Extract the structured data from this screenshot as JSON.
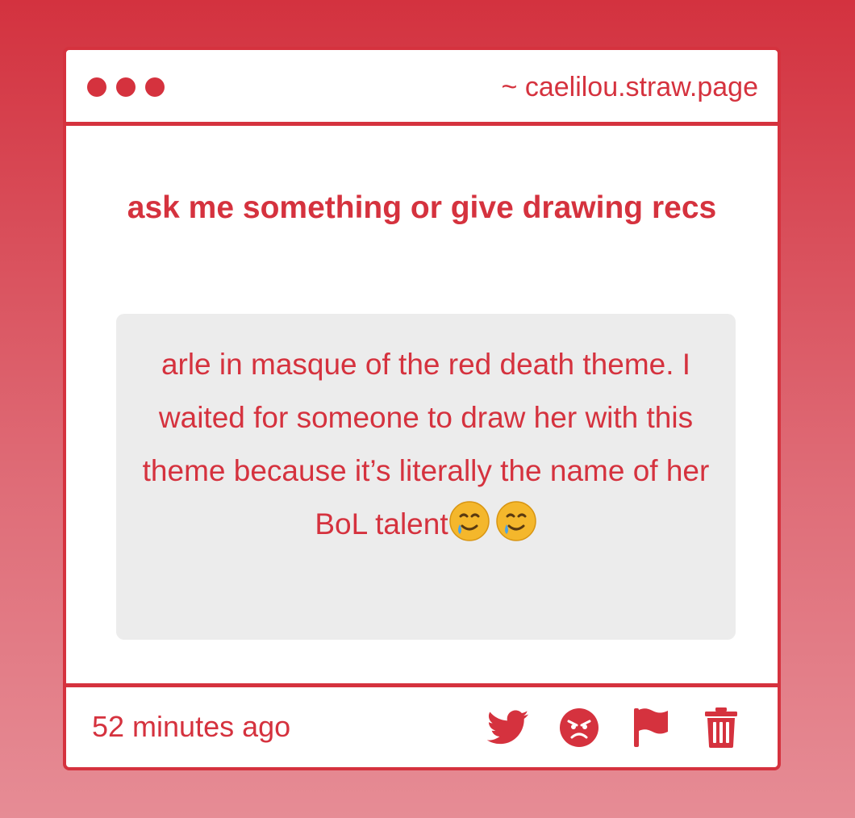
{
  "window": {
    "domain": "~ caelilou.straw.page"
  },
  "question": {
    "prompt": "ask me something or give drawing recs"
  },
  "answer": {
    "text": "arle in masque of the red death theme. I waited for someone to draw her with this theme because it’s literally the name of her BoL talent",
    "emoji": [
      "smiling-face-with-tear",
      "smiling-face-with-tear"
    ]
  },
  "footer": {
    "time": "52 minutes ago",
    "actions": [
      "twitter-icon",
      "angry-face-icon",
      "flag-icon",
      "trash-icon"
    ]
  },
  "colors": {
    "accent": "#d5323e",
    "bubble": "#ececec"
  }
}
